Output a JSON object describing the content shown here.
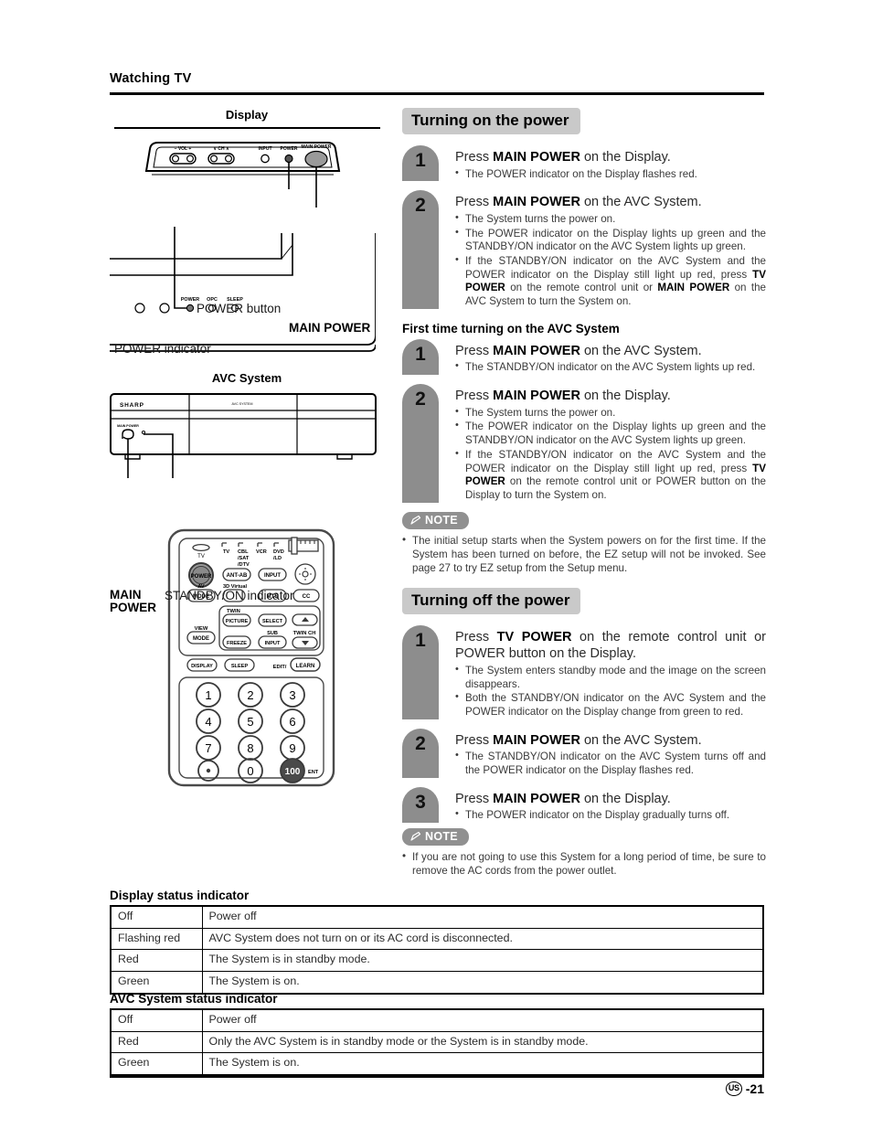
{
  "header": {
    "title": "Watching TV"
  },
  "left": {
    "display_caption": "Display",
    "display_labels": {
      "power_button": "POWER button",
      "main_power": "MAIN POWER",
      "power_indicator": "POWER indicator"
    },
    "display_panel_keys": [
      "VOL",
      "CH",
      "INPUT",
      "POWER",
      "MAIN POWER"
    ],
    "display_panel_vol_minus": "– VOL +",
    "display_panel_ch": "∨ CH ∧",
    "display_indicator_labels": [
      "POWER",
      "OPC",
      "SLEEP"
    ],
    "avc_caption": "AVC System",
    "avc_brand": "SHARP",
    "avc_labels": {
      "main_power_line1": "MAIN",
      "main_power_line2": "POWER",
      "standby_indicator": "STANDBY/ON  indicator"
    },
    "remote": {
      "source_labels": [
        "TV",
        "CBL\n/SAT\n/DTV",
        "VCR",
        "DVD\n/LD"
      ],
      "tv_led_label": "TV",
      "power_button": "POWER",
      "buttons_row1": [
        "ANT-AB",
        "INPUT"
      ],
      "av_mode_top": "AV",
      "av_mode": "MODE",
      "virtual_label": "Virtual",
      "mts": "MTS",
      "cc": "CC",
      "twin_group_label": "TWIN",
      "twin_picture": "PICTURE",
      "select": "SELECT",
      "sub_label": "SUB",
      "twin_ch_label": "TWIN CH",
      "freeze": "FREEZE",
      "input": "INPUT",
      "view_label": "VIEW",
      "view_mode": "MODE",
      "display": "DISPLAY",
      "sleep": "SLEEP",
      "edit_label": "EDIT/",
      "learn": "LEARN",
      "keypad": [
        "1",
        "2",
        "3",
        "4",
        "5",
        "6",
        "7",
        "8",
        "9",
        "•",
        "0",
        "100"
      ],
      "ent_label": "ENT",
      "up_arrow": "▲",
      "down_arrow": "▼"
    }
  },
  "right": {
    "section_on": {
      "title": "Turning on the power"
    },
    "on_steps": [
      {
        "num": "1",
        "lead_pre": "Press ",
        "lead_bold": "MAIN POWER",
        "lead_post": " on the Display.",
        "bullets": [
          {
            "text": "The POWER indicator on the Display flashes red."
          }
        ]
      },
      {
        "num": "2",
        "lead_pre": "Press ",
        "lead_bold": "MAIN POWER",
        "lead_post": " on the AVC System.",
        "bullets": [
          {
            "text": "The System turns the power on."
          },
          {
            "text": "The POWER indicator on the Display lights up green and the STANDBY/ON indicator on the AVC System lights up green."
          },
          {
            "text": "If the STANDBY/ON indicator on the AVC System and the POWER indicator on the Display still light up red, press TV POWER on the remote control unit or MAIN POWER on the AVC System to turn the System on.",
            "bold_parts": [
              "TV POWER",
              "MAIN POWER"
            ]
          }
        ]
      }
    ],
    "first_time_heading": "First time turning on the AVC System",
    "first_time_steps": [
      {
        "num": "1",
        "lead_pre": "Press ",
        "lead_bold": "MAIN POWER",
        "lead_post": " on the AVC System.",
        "bullets": [
          {
            "text": "The STANDBY/ON indicator on the AVC System lights up red."
          }
        ]
      },
      {
        "num": "2",
        "lead_pre": "Press ",
        "lead_bold": "MAIN POWER",
        "lead_post": " on the Display.",
        "bullets": [
          {
            "text": "The System turns the power on."
          },
          {
            "text": "The POWER indicator on the Display lights up green and the STANDBY/ON indicator on the AVC System lights up green."
          },
          {
            "text": "If the STANDBY/ON indicator on the AVC System and the POWER indicator on the Display still light up red, press TV POWER on the remote control unit or POWER button on the Display to turn the System on.",
            "bold_parts": [
              "TV POWER"
            ]
          }
        ]
      }
    ],
    "note1": {
      "badge": "NOTE",
      "items": [
        "The initial setup starts when the System powers on for the first time. If the System has been turned on before, the EZ setup will not be invoked. See page 27 to try EZ setup from the Setup menu."
      ]
    },
    "section_off": {
      "title": "Turning off the power"
    },
    "off_steps": [
      {
        "num": "1",
        "lead_pre": "Press ",
        "lead_bold": "TV POWER",
        "lead_post": " on the remote control unit or POWER button on the Display.",
        "bullets": [
          {
            "text": "The System enters standby mode and the image on the screen disappears."
          },
          {
            "text": "Both the STANDBY/ON indicator on the AVC System and the POWER indicator on the Display change from green to red."
          }
        ]
      },
      {
        "num": "2",
        "lead_pre": "Press ",
        "lead_bold": "MAIN POWER",
        "lead_post": " on the AVC System.",
        "bullets": [
          {
            "text": "The STANDBY/ON indicator on the AVC System turns off and the POWER indicator on the Display flashes red."
          }
        ]
      },
      {
        "num": "3",
        "lead_pre": "Press ",
        "lead_bold": "MAIN POWER",
        "lead_post": " on the Display.",
        "bullets": [
          {
            "text": "The POWER indicator on the Display gradually turns off."
          }
        ]
      }
    ],
    "note2": {
      "badge": "NOTE",
      "items": [
        "If you are not going to use this System for a long period of time, be sure to remove the AC cords from the power outlet."
      ]
    }
  },
  "tables": [
    {
      "title": "Display status indicator",
      "rows": [
        {
          "state": "Off",
          "desc": "Power off"
        },
        {
          "state": "Flashing red",
          "desc": "AVC System does not turn on or its AC cord is disconnected."
        },
        {
          "state": "Red",
          "desc": "The System is in standby mode."
        },
        {
          "state": "Green",
          "desc": "The System is on."
        }
      ]
    },
    {
      "title": "AVC System status indicator",
      "rows": [
        {
          "state": "Off",
          "desc": "Power off"
        },
        {
          "state": "Red",
          "desc": "Only the AVC System is in standby mode or the System is in standby mode."
        },
        {
          "state": "Green",
          "desc": "The System is on."
        }
      ]
    }
  ],
  "footer": {
    "region": "US",
    "page": "-21"
  },
  "colors": {
    "section_bar": "#c9c9c9",
    "step_num": "#8d8d8d",
    "note_badge": "#909090"
  }
}
